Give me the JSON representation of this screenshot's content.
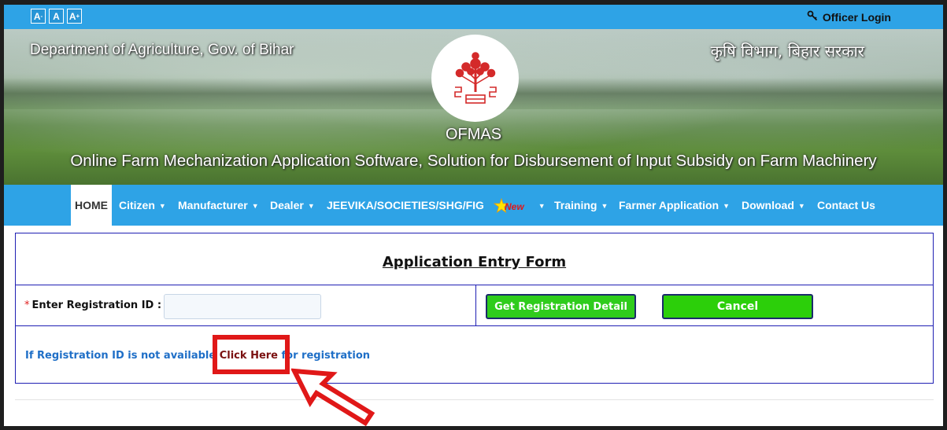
{
  "topbar": {
    "font_decrease": "A",
    "font_normal": "A",
    "font_increase": "A",
    "login_label": "Officer Login",
    "login_icon": "key-icon"
  },
  "banner": {
    "left_text": "Department of Agriculture, Gov. of Bihar",
    "right_text": "कृषि विभाग, बिहार सरकार",
    "title": "OFMAS",
    "subtitle": "Online Farm Mechanization Application Software, Solution for Disbursement of Input Subsidy on Farm Machinery",
    "logo_icon": "bihar-emblem-icon"
  },
  "nav": {
    "items": [
      {
        "label": "HOME",
        "active": true
      },
      {
        "label": "Citizen"
      },
      {
        "label": "Manufacturer"
      },
      {
        "label": "Dealer"
      },
      {
        "label": "JEEVIKA/SOCIETIES/SHG/FIG"
      },
      {
        "label": "Training"
      },
      {
        "label": "Farmer Application"
      },
      {
        "label": "Download"
      },
      {
        "label": "Contact Us"
      }
    ],
    "new_badge": "New"
  },
  "form": {
    "title": "Application Entry Form",
    "reg_label": "Enter Registration ID :",
    "required_mark": "*",
    "reg_value": "",
    "get_button": "Get Registration Detail",
    "cancel_button": "Cancel",
    "note_before": "If Registration ID is not available ",
    "note_link": "Click Here",
    "note_after": " for registration"
  },
  "colors": {
    "accent": "#2ea3e6",
    "button_green": "#2fcc1c",
    "highlight_red": "#e01818",
    "border_blue": "#1f1fb3"
  }
}
